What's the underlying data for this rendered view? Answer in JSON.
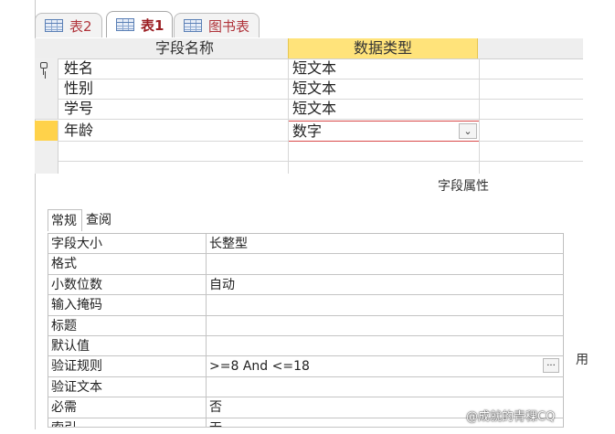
{
  "tabs": [
    {
      "label": "表2",
      "active": false
    },
    {
      "label": "表1",
      "active": true
    },
    {
      "label": "图书表",
      "active": false
    }
  ],
  "grid": {
    "header": {
      "field_name": "字段名称",
      "data_type": "数据类型"
    },
    "rows": [
      {
        "name": "姓名",
        "type": "短文本",
        "primary_key": true
      },
      {
        "name": "性别",
        "type": "短文本"
      },
      {
        "name": "学号",
        "type": "短文本"
      },
      {
        "name": "年龄",
        "type": "数字",
        "current": true
      }
    ]
  },
  "properties": {
    "section_label": "字段属性",
    "tabs": [
      "常规",
      "查阅"
    ],
    "rows": [
      {
        "label": "字段大小",
        "value": "长整型"
      },
      {
        "label": "格式",
        "value": ""
      },
      {
        "label": "小数位数",
        "value": "自动"
      },
      {
        "label": "输入掩码",
        "value": ""
      },
      {
        "label": "标题",
        "value": ""
      },
      {
        "label": "默认值",
        "value": ""
      },
      {
        "label": "验证规则",
        "value": ">=8 And <=18"
      },
      {
        "label": "验证文本",
        "value": ""
      },
      {
        "label": "必需",
        "value": "否"
      },
      {
        "label": "索引",
        "value": "无"
      }
    ]
  },
  "side_char": "用",
  "watermark": "@成就的青稞CQ",
  "colors": {
    "header_highlight": "#ffe37a",
    "current_row": "#ffd24a",
    "active_tab_text": "#9b1d22",
    "edit_border": "#d94a4a"
  }
}
